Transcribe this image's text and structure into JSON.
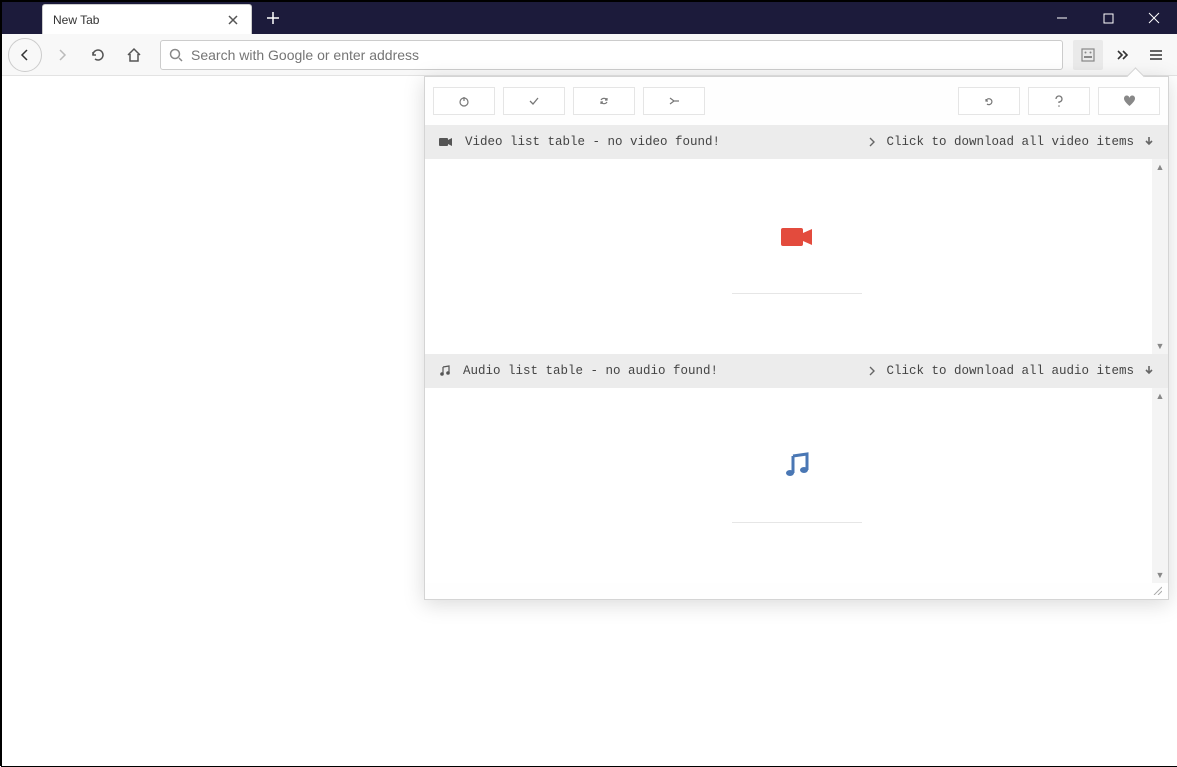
{
  "window": {
    "tab_title": "New Tab"
  },
  "addressbar": {
    "placeholder": "Search with Google or enter address"
  },
  "panel": {
    "video_header": {
      "label": "Video list table - no video found!",
      "action": "Click to download all video items"
    },
    "audio_header": {
      "label": "Audio list table - no audio found!",
      "action": "Click to download all audio items"
    }
  }
}
